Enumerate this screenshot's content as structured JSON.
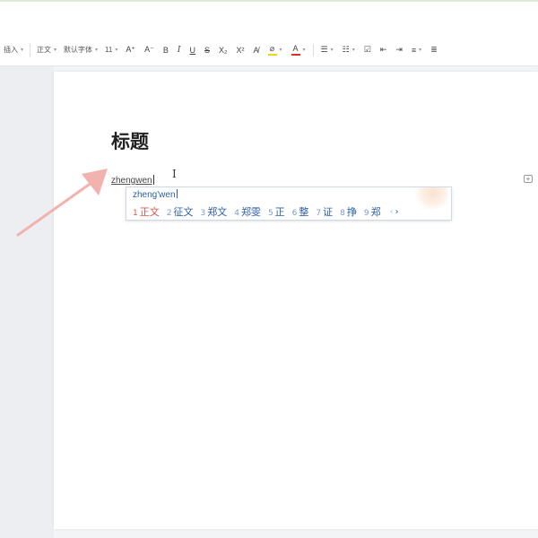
{
  "toolbar": {
    "insert_label": "插入",
    "style_label": "正文",
    "font_label": "默认字体",
    "size_label": "11",
    "grow_font": "A⁺",
    "shrink_font": "A⁻",
    "bold": "B",
    "italic": "I",
    "underline": "U",
    "strike": "S",
    "subscript": "X₂",
    "superscript": "X²",
    "clear_format": "A̸",
    "highlight_color": "#f2d600",
    "font_color": "#d93025"
  },
  "document": {
    "heading": "标题",
    "typed_text": "zhengwen"
  },
  "ime": {
    "pinyin": "zheng'wen",
    "candidates": [
      {
        "num": "1",
        "text": "正文"
      },
      {
        "num": "2",
        "text": "征文"
      },
      {
        "num": "3",
        "text": "郑文"
      },
      {
        "num": "4",
        "text": "郑雯"
      },
      {
        "num": "5",
        "text": "正"
      },
      {
        "num": "6",
        "text": "整"
      },
      {
        "num": "7",
        "text": "证"
      },
      {
        "num": "8",
        "text": "挣"
      },
      {
        "num": "9",
        "text": "郑"
      }
    ],
    "prev": "‹",
    "next": "›"
  }
}
